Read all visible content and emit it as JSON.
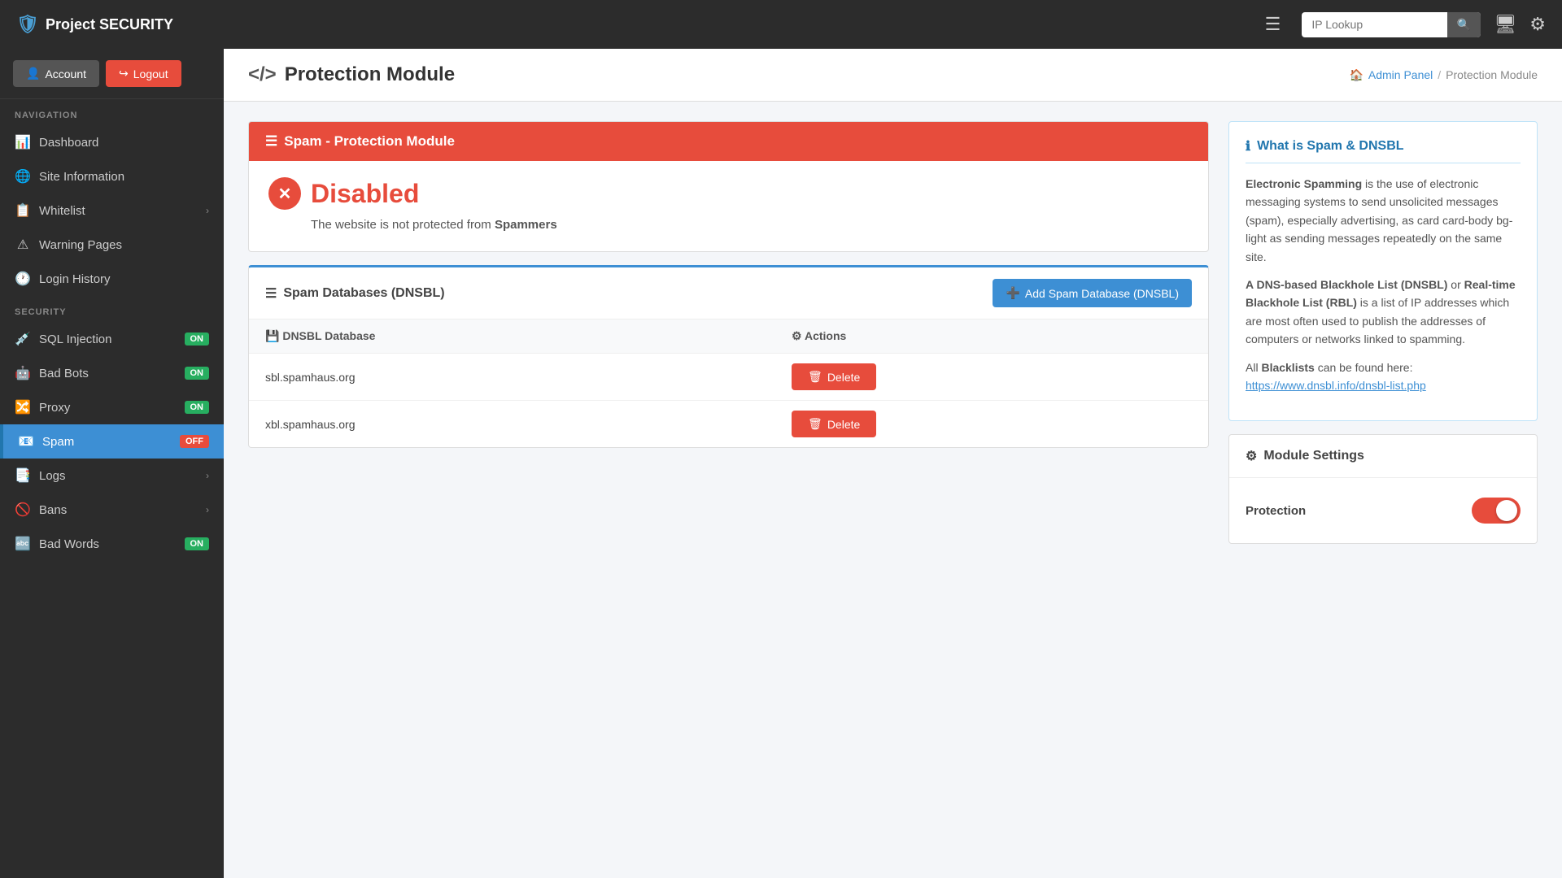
{
  "app": {
    "brand": "Project SECURITY",
    "shield_icon": "🛡"
  },
  "topbar": {
    "hamburger_label": "☰",
    "search_placeholder": "IP Lookup",
    "search_icon": "🔍",
    "monitor_icon": "🖥",
    "settings_icon": "⚙"
  },
  "sidebar": {
    "account_label": "Account",
    "logout_label": "Logout",
    "nav_section": "NAVIGATION",
    "security_section": "SECURITY",
    "nav_items": [
      {
        "id": "dashboard",
        "label": "Dashboard",
        "icon": "📊",
        "badge": null,
        "has_arrow": false
      },
      {
        "id": "site-information",
        "label": "Site Information",
        "icon": "🌐",
        "badge": null,
        "has_arrow": false
      },
      {
        "id": "whitelist",
        "label": "Whitelist",
        "icon": "📋",
        "badge": null,
        "has_arrow": true
      },
      {
        "id": "warning-pages",
        "label": "Warning Pages",
        "icon": "⚠",
        "badge": null,
        "has_arrow": false
      },
      {
        "id": "login-history",
        "label": "Login History",
        "icon": "🕐",
        "badge": null,
        "has_arrow": false
      }
    ],
    "security_items": [
      {
        "id": "sql-injection",
        "label": "SQL Injection",
        "icon": "💉",
        "badge": "ON",
        "badge_type": "on",
        "has_arrow": false
      },
      {
        "id": "bad-bots",
        "label": "Bad Bots",
        "icon": "🤖",
        "badge": "ON",
        "badge_type": "on",
        "has_arrow": false
      },
      {
        "id": "proxy",
        "label": "Proxy",
        "icon": "🔀",
        "badge": "ON",
        "badge_type": "on",
        "has_arrow": false
      },
      {
        "id": "spam",
        "label": "Spam",
        "icon": "📧",
        "badge": "OFF",
        "badge_type": "off",
        "has_arrow": false,
        "active": true
      },
      {
        "id": "logs",
        "label": "Logs",
        "icon": "📑",
        "badge": null,
        "has_arrow": true
      },
      {
        "id": "bans",
        "label": "Bans",
        "icon": "🚫",
        "badge": null,
        "has_arrow": true
      },
      {
        "id": "bad-words",
        "label": "Bad Words",
        "icon": "🔤",
        "badge": "ON",
        "badge_type": "on",
        "has_arrow": false
      }
    ]
  },
  "content": {
    "page_title": "Protection Module",
    "code_icon": "</>",
    "breadcrumb": {
      "home_icon": "🏠",
      "admin_panel_label": "Admin Panel",
      "separator": "/",
      "current": "Protection Module"
    },
    "module_header": "Spam - Protection Module",
    "status_title": "Disabled",
    "status_desc_prefix": "The website is not protected from",
    "status_desc_bold": "Spammers",
    "dnsbl": {
      "section_icon": "☰",
      "section_title": "Spam Databases (DNSBL)",
      "add_button_label": "Add Spam Database (DNSBL)",
      "col_database": "DNSBL Database",
      "col_actions": "Actions",
      "rows": [
        {
          "id": "row1",
          "db": "sbl.spamhaus.org",
          "delete_label": "Delete"
        },
        {
          "id": "row2",
          "db": "xbl.spamhaus.org",
          "delete_label": "Delete"
        }
      ]
    }
  },
  "sidebar_info": {
    "what_is_title": "What is Spam & DNSBL",
    "info_icon": "ℹ",
    "paragraphs": [
      {
        "bold_start": "Electronic Spamming",
        "text": " is the use of electronic messaging systems to send unsolicited messages (spam), especially advertising, as card card-body bg-light as sending messages repeatedly on the same site."
      },
      {
        "bold_start": "A DNS-based Blackhole List (DNSBL)",
        "bold_or": " or ",
        "bold_rbl": "Real-time Blackhole List (RBL)",
        "text": " is a list of IP addresses which are most often used to publish the addresses of computers or networks linked to spamming."
      },
      {
        "prefix": "All ",
        "bold": "Blacklists",
        "suffix": " can be found here:",
        "link_text": "https://www.dnsbl.info/dnsbl-list.php",
        "link_url": "https://www.dnsbl.info/dnsbl-list.php"
      }
    ],
    "module_settings": {
      "title": "Module Settings",
      "settings_icon": "⚙",
      "protection_label": "Protection"
    }
  }
}
